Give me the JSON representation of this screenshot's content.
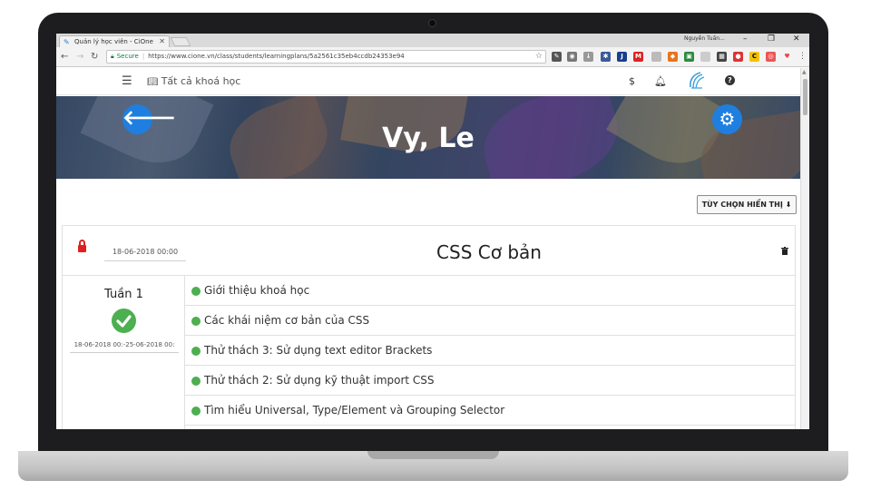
{
  "browser": {
    "tab_title": "Quản lý học viên - CiOne",
    "user": "Nguyễn Tuấn...",
    "secure_label": "Secure",
    "url": "https://www.cione.vn/class/students/learningplans/5a2561c35eb4ccdb24353e94"
  },
  "header": {
    "menu_label": "Tất cả khoá học",
    "dollar_icon": "$"
  },
  "banner": {
    "title": "Vy, Le"
  },
  "toolbar": {
    "display_options": "TÙY CHỌN HIỂN THỊ ⬇"
  },
  "course": {
    "date": "18-06-2018 00:00",
    "title": "CSS Cơ bản"
  },
  "week": {
    "label": "Tuần 1",
    "range": "18-06-2018 00:-25-06-2018 00:"
  },
  "lessons": [
    {
      "title": "Giới thiệu khoá học",
      "status_color": "#4caf50"
    },
    {
      "title": "Các khái niệm cơ bản của CSS",
      "status_color": "#4caf50"
    },
    {
      "title": "Thử thách 3: Sử dụng text editor Brackets",
      "status_color": "#4caf50"
    },
    {
      "title": "Thử thách 2: Sử dụng kỹ thuật import CSS",
      "status_color": "#4caf50"
    },
    {
      "title": "Tìm hiểu Universal, Type/Element và Grouping Selector",
      "status_color": "#4caf50"
    }
  ],
  "colors": {
    "accent_blue": "#1e7fe0",
    "complete_green": "#4caf50",
    "lock_red": "#e02020"
  }
}
